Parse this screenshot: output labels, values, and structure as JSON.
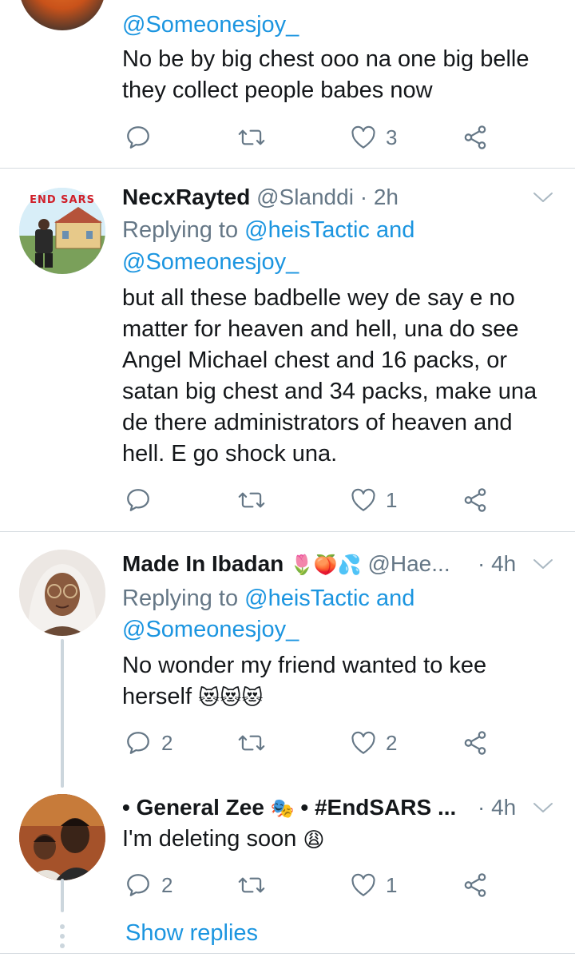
{
  "tweet0": {
    "mention": "@Someonesjoy_",
    "text_lines": [
      "No be by big chest ooo na one big belle",
      "they collect people babes now"
    ],
    "reply_count": "",
    "retweet_count": "",
    "like_count": "3"
  },
  "tweet1": {
    "display_name": "NecxRayted",
    "handle": "@Slanddi",
    "dot": "·",
    "time": "2h",
    "replying_prefix": "Replying to ",
    "replying_to": "@heisTactic and",
    "replying_to_2": "@Someonesjoy_",
    "text_lines": [
      "but all these badbelle wey de say e no",
      "matter for heaven and hell, una do see",
      "Angel Michael chest and 16 packs, or",
      "satan big chest and 34 packs, make una",
      "de there administrators of heaven and",
      "hell. E go shock una."
    ],
    "avatar_banner_text": "END SARS",
    "reply_count": "",
    "retweet_count": "",
    "like_count": "1"
  },
  "tweet2": {
    "display_name": "Made In Ibadan",
    "name_emojis": "🌷🍑💦",
    "handle": "@Hae...",
    "dot": "·",
    "time": "4h",
    "replying_prefix": "Replying to ",
    "replying_to": "@heisTactic and",
    "replying_to_2": "@Someonesjoy_",
    "text_lines": [
      "No wonder my friend wanted to kee",
      "herself"
    ],
    "text_emojis": "😻😻😻",
    "reply_count": "2",
    "retweet_count": "",
    "like_count": "2"
  },
  "tweet3": {
    "display_name_prefix": "•",
    "display_name": "General Zee",
    "name_emoji": "🎭",
    "name_suffix": "• #EndSARS ...",
    "dot": "·",
    "time": "4h",
    "text": "I'm deleting soon",
    "text_emoji": "😩",
    "reply_count": "2",
    "retweet_count": "",
    "like_count": "1"
  },
  "show_replies": "Show replies",
  "colors": {
    "accent": "#1b95e0",
    "secondary": "#657786",
    "divider": "#d5dbe0"
  }
}
